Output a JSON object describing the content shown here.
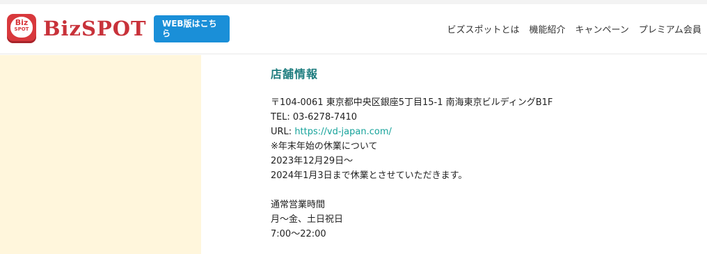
{
  "header": {
    "logo_icon_text_top": "Biz",
    "logo_icon_text_bottom": "SPOT",
    "logo_text": "BizSPOT",
    "web_button_label": "WEB版はこちら",
    "nav": [
      {
        "label": "ビズスポットとは"
      },
      {
        "label": "機能紹介"
      },
      {
        "label": "キャンペーン"
      },
      {
        "label": "プレミアム会員"
      }
    ]
  },
  "store": {
    "title": "店舗情報",
    "address": "〒104-0061 東京都中央区銀座5丁目15-1 南海東京ビルディングB1F",
    "tel": "TEL: 03-6278-7410",
    "url_label": "URL: ",
    "url": "https://vd-japan.com/",
    "notice_heading": "※年末年始の休業について",
    "notice_from": "2023年12月29日〜",
    "notice_to": "2024年1月3日まで休業とさせていただきます。",
    "hours_heading": "通常営業時間",
    "hours_days": "月〜金、土日祝日",
    "hours_time": "7:00〜22:00"
  },
  "colors": {
    "brand_red": "#c8323a",
    "button_blue": "#1a8fd8",
    "title_teal": "#1f7d7f",
    "link_teal": "#17a39b",
    "left_panel": "#fff6dc"
  }
}
